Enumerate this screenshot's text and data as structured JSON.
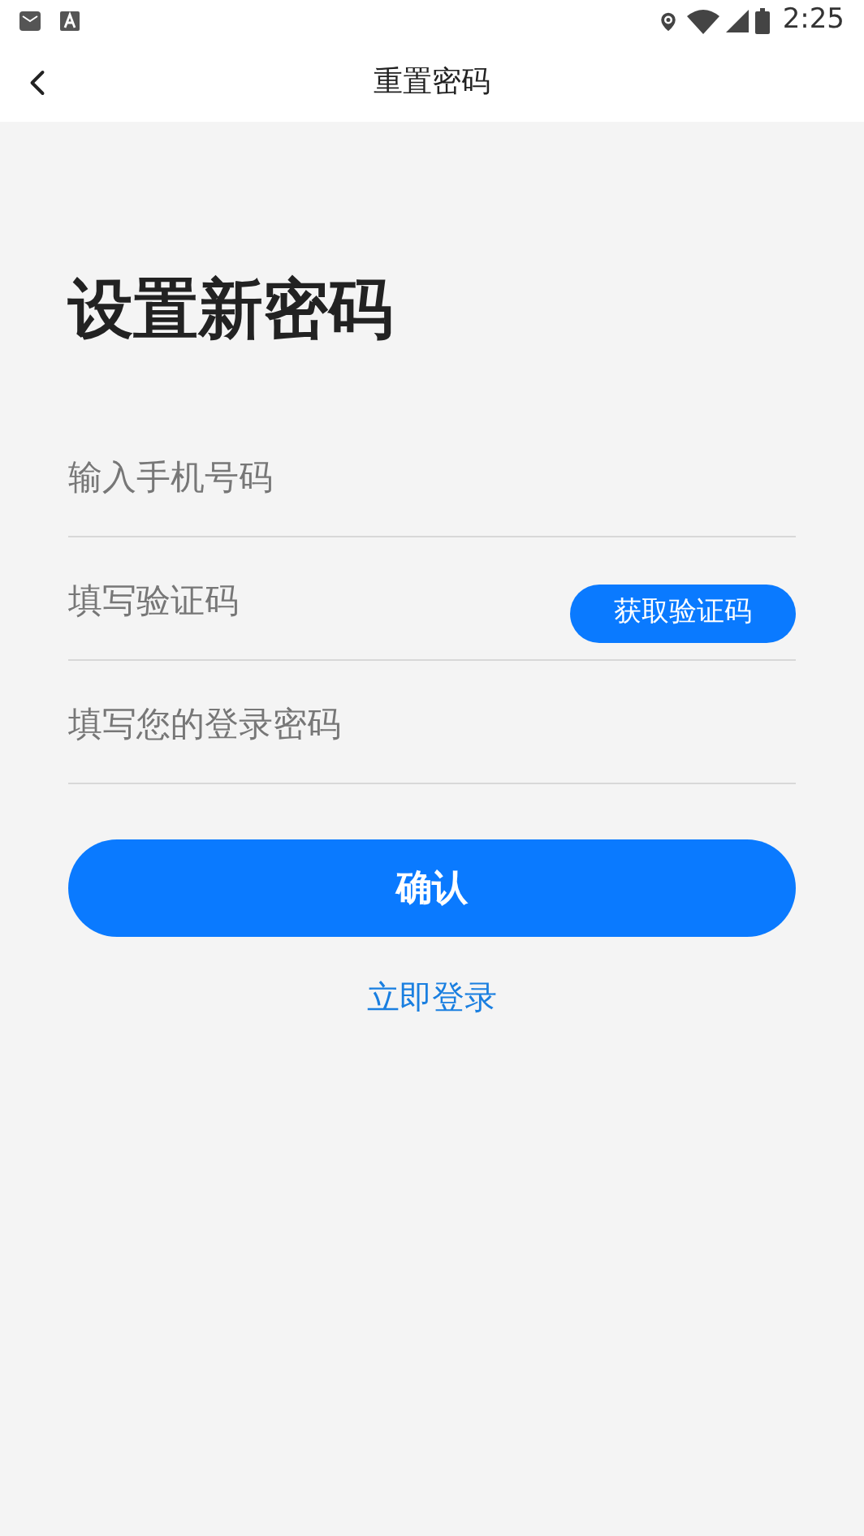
{
  "status_bar": {
    "time": "2:25"
  },
  "header": {
    "title": "重置密码"
  },
  "heading": "设置新密码",
  "fields": [
    {
      "placeholder": "输入手机号码"
    },
    {
      "placeholder": "填写验证码",
      "action": "获取验证码"
    },
    {
      "placeholder": "填写您的登录密码"
    }
  ],
  "confirm_button": "确认",
  "login_link": "立即登录"
}
